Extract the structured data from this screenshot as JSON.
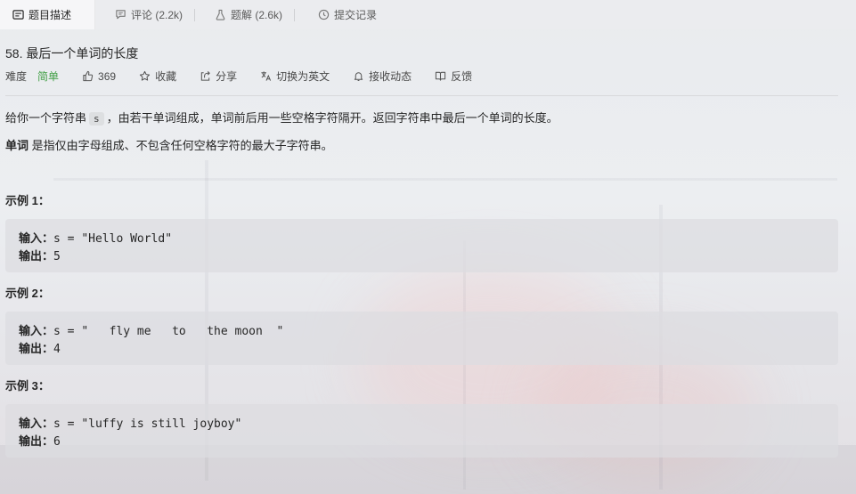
{
  "tabs": [
    {
      "label": "题目描述",
      "icon": "description-icon",
      "active": true
    },
    {
      "label": "评论 (2.2k)",
      "icon": "comment-icon",
      "active": false
    },
    {
      "label": "题解 (2.6k)",
      "icon": "flask-icon",
      "active": false
    },
    {
      "label": "提交记录",
      "icon": "clock-icon",
      "active": false
    }
  ],
  "problem": {
    "title": "58. 最后一个单词的长度",
    "difficulty_label": "难度",
    "difficulty": "简单",
    "difficulty_color": "#43a047",
    "likes": "369",
    "favorite": "收藏",
    "share": "分享",
    "switch_lang": "切换为英文",
    "subscribe": "接收动态",
    "feedback": "反馈"
  },
  "description": {
    "p1_before": "给你一个字符串",
    "p1_code": "s",
    "p1_after": "，由若干单词组成，单词前后用一些空格字符隔开。返回字符串中最后一个单词的长度。",
    "p2_bold": "单词",
    "p2_rest": " 是指仅由字母组成、不包含任何空格字符的最大子字符串。"
  },
  "examples": [
    {
      "title": "示例 1：",
      "input_label": "输入：",
      "input": "s = \"Hello World\"",
      "output_label": "输出：",
      "output": "5"
    },
    {
      "title": "示例 2：",
      "input_label": "输入：",
      "input": "s = \"   fly me   to   the moon  \"",
      "output_label": "输出：",
      "output": "4"
    },
    {
      "title": "示例 3：",
      "input_label": "输入：",
      "input": "s = \"luffy is still joyboy\"",
      "output_label": "输出：",
      "output": "6"
    }
  ]
}
